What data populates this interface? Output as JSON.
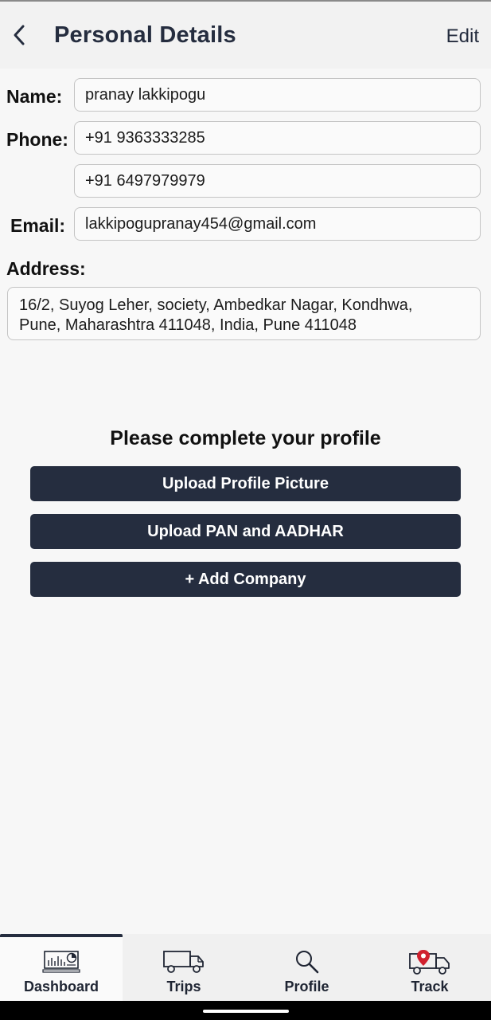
{
  "header": {
    "title": "Personal Details",
    "edit_label": "Edit"
  },
  "form": {
    "name_label": "Name:",
    "name_value": "pranay lakkipogu",
    "phone_label": "Phone:",
    "phone_primary": "+91 9363333285",
    "phone_secondary": "+91 6497979979",
    "email_label": "Email:",
    "email_value": "lakkipogupranay454@gmail.com",
    "address_label": "Address:",
    "address_line1": "16/2, Suyog Leher, society, Ambedkar Nagar, Kondhwa,",
    "address_line2": "Pune, Maharashtra 411048, India, Pune 411048"
  },
  "profile": {
    "prompt": "Please complete your profile",
    "upload_picture": "Upload Profile Picture",
    "upload_docs": "Upload PAN and AADHAR",
    "add_company": "+ Add Company"
  },
  "nav": {
    "items": [
      {
        "label": "Dashboard",
        "icon": "dashboard-icon",
        "active": true
      },
      {
        "label": "Trips",
        "icon": "truck-icon",
        "active": false
      },
      {
        "label": "Profile",
        "icon": "search-icon",
        "active": false
      },
      {
        "label": "Track",
        "icon": "truck-location-icon",
        "active": false
      }
    ]
  },
  "colors": {
    "primary": "#252d3f",
    "accent": "#d0202e"
  }
}
